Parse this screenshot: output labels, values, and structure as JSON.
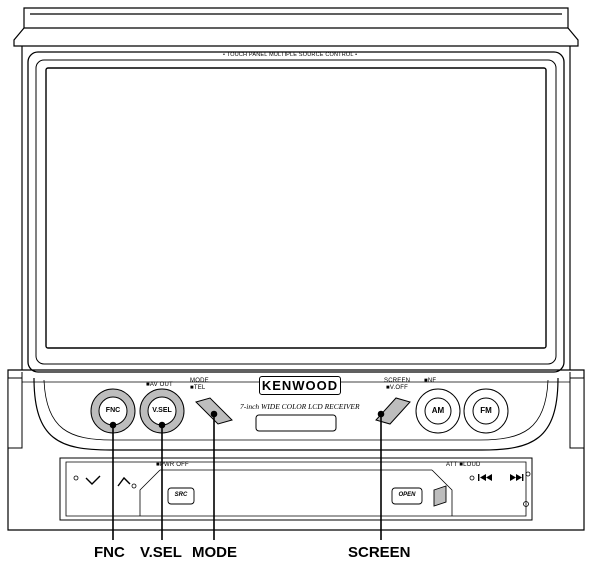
{
  "panel": {
    "top_caption": "• TOUCH PANEL MULTIPLE SOURCE CONTROL •",
    "brand": "KENWOOD",
    "model_desc": "7-inch WIDE COLOR LCD RECEIVER"
  },
  "buttons": {
    "fnc": "FNC",
    "vsel": "V.SEL",
    "am": "AM",
    "fm": "FM",
    "src": "SRC",
    "open": "OPEN"
  },
  "small_labels": {
    "av_out": "■AV OUT",
    "mode": "MODE",
    "tel": "■TEL",
    "screen": "SCREEN",
    "v_off": "■V.OFF",
    "nf": "■NF",
    "pwr_off": "■PWR OFF",
    "att_loud": "ATT ■LOUD"
  },
  "callouts": {
    "fnc": "FNC",
    "vsel": "V.SEL",
    "mode": "MODE",
    "screen": "SCREEN"
  }
}
